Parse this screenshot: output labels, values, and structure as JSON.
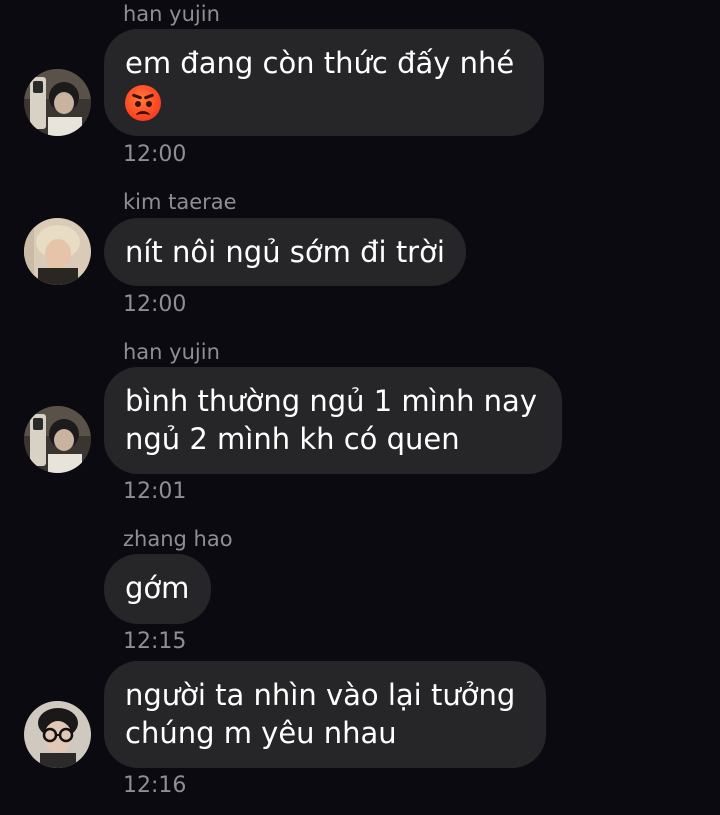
{
  "messages": [
    {
      "sender": "han yujin",
      "text": "em đang còn thức đấy nhé",
      "emoji": "angry-face-icon",
      "time": "12:00",
      "avatar": "avatar-han-yujin"
    },
    {
      "sender": "kim taerae",
      "text": "nít nôi ngủ sớm đi trời",
      "time": "12:00",
      "avatar": "avatar-kim-taerae"
    },
    {
      "sender": "han yujin",
      "text": "bình thường ngủ 1 mình nay\nngủ 2 mình kh có quen",
      "time": "12:01",
      "avatar": "avatar-han-yujin"
    },
    {
      "sender": "zhang hao",
      "text": "gớm",
      "time": "12:15"
    },
    {
      "text": "người ta nhìn vào lại tưởng\nchúng m yêu nhau",
      "time": "12:16",
      "avatar": "avatar-zhang-hao"
    }
  ],
  "colors": {
    "background": "#0b0a10",
    "bubble": "#262629",
    "meta_text": "#8e8e93",
    "message_text": "#ffffff"
  }
}
